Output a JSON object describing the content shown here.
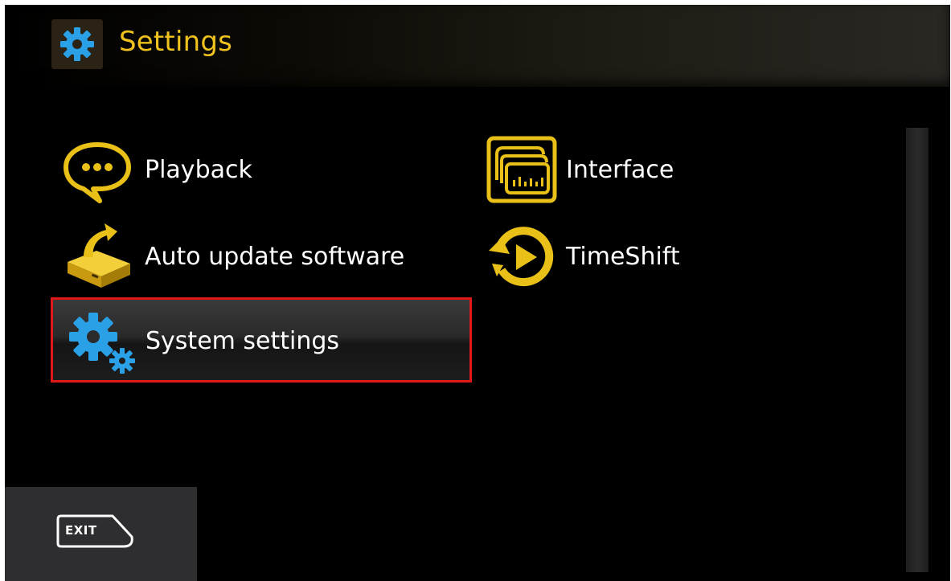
{
  "header": {
    "title": "Settings",
    "icon": "gear-icon"
  },
  "menu": {
    "items": [
      {
        "label": "Playback",
        "icon": "speech-bubble-icon"
      },
      {
        "label": "Interface",
        "icon": "screen-icon"
      },
      {
        "label": "Auto update software",
        "icon": "update-box-icon"
      },
      {
        "label": "TimeShift",
        "icon": "timeshift-icon"
      },
      {
        "label": "System settings",
        "icon": "gears-icon",
        "selected": true
      }
    ]
  },
  "footer": {
    "exit_label": "EXIT"
  },
  "colors": {
    "accent": "#efc21e",
    "icon_yellow": "#e8c018",
    "gear_blue": "#2aa0e6",
    "selection_border": "#e01818",
    "background": "#000000"
  }
}
